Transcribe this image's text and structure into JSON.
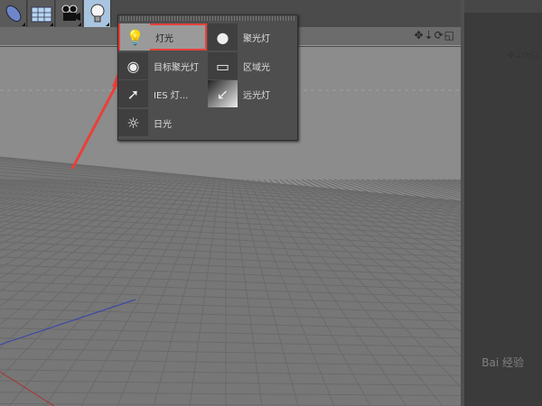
{
  "toolbar": {
    "items": [
      {
        "name": "object-tool",
        "active": false
      },
      {
        "name": "environment-tool",
        "active": false
      },
      {
        "name": "camera-tool",
        "active": false
      },
      {
        "name": "light-tool",
        "active": true
      }
    ]
  },
  "viewport": {
    "header_icons": "✥⇣⟳◱"
  },
  "menu": {
    "items": {
      "light": "灯光",
      "target_spot": "目标聚光灯",
      "ies": "IES 灯...",
      "sun": "日光",
      "spot": "聚光灯",
      "area": "区域光",
      "infinite": "远光灯"
    }
  },
  "colors": {
    "highlight": "#e8403a",
    "active_tool": "#a9c4de"
  },
  "watermark": "Bai 经验"
}
